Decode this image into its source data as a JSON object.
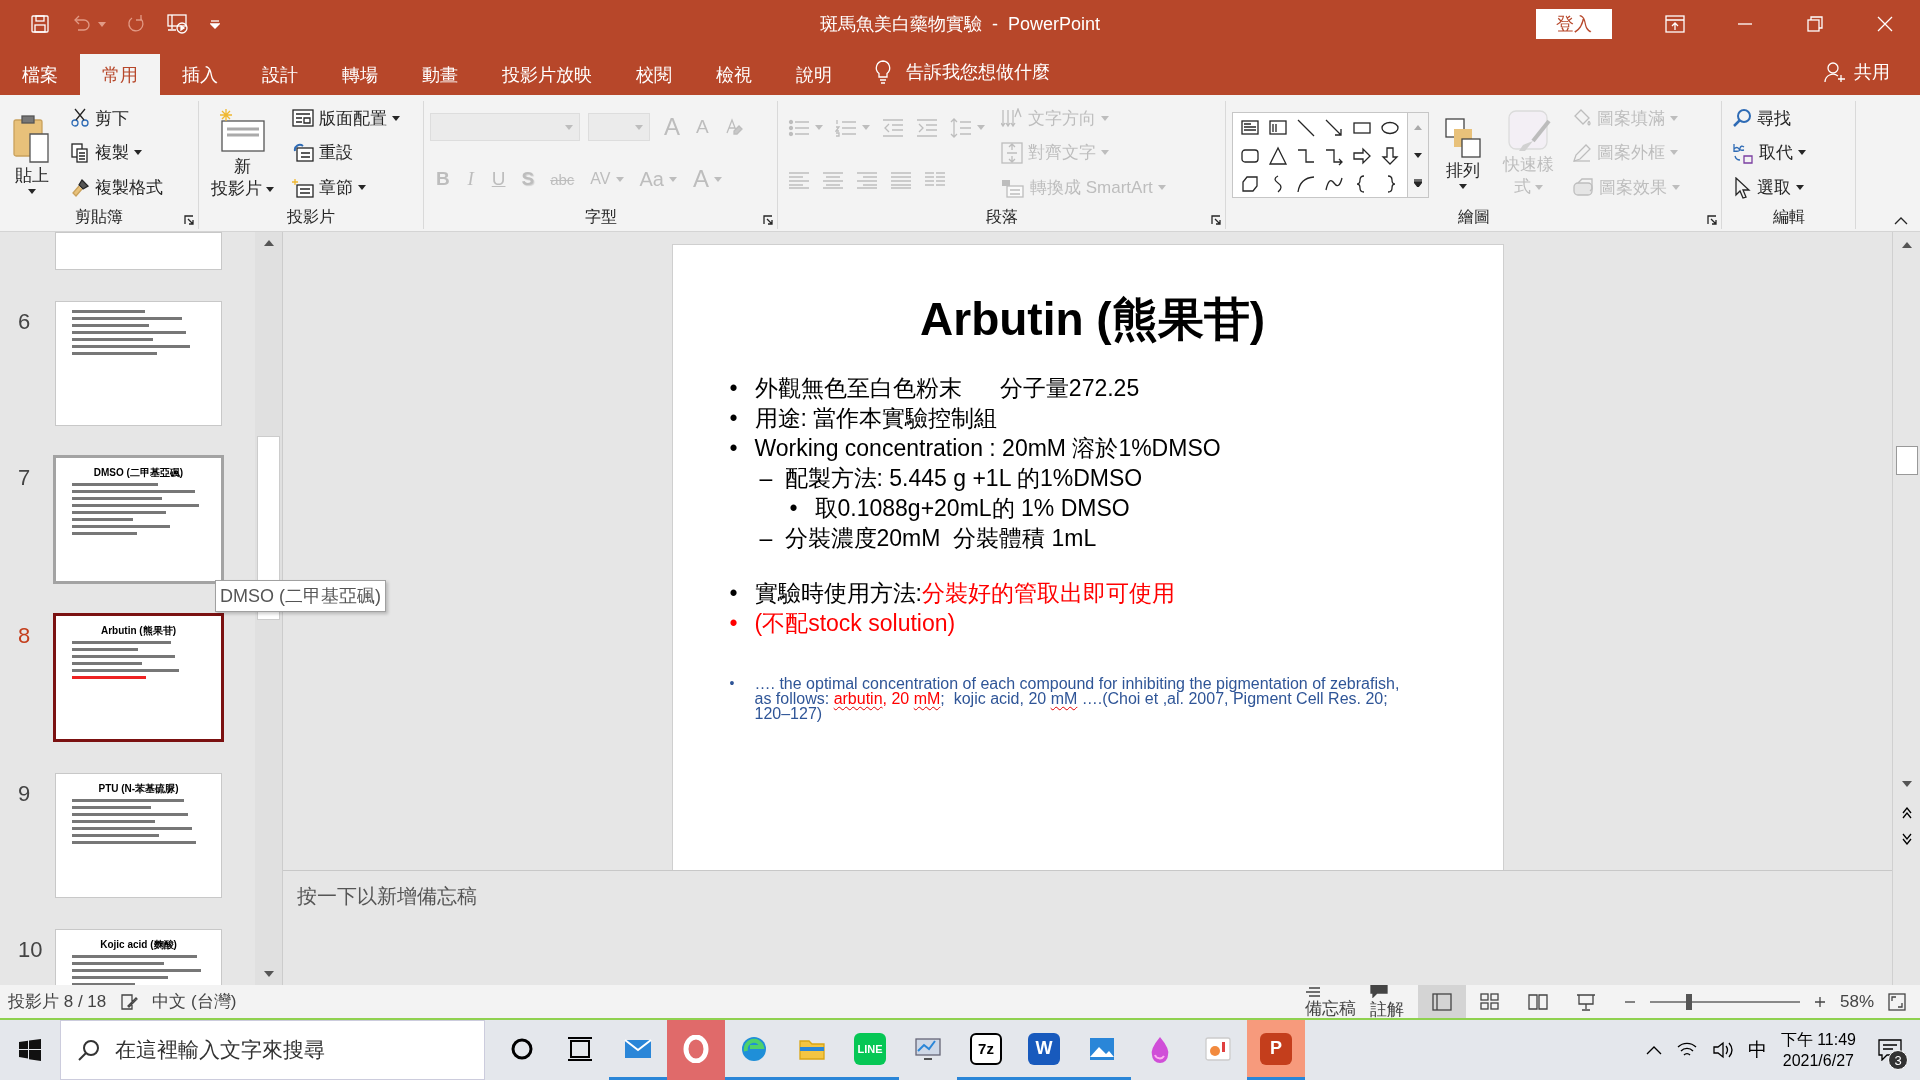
{
  "window": {
    "title": "斑馬魚美白藥物實驗  -  PowerPoint",
    "sign_in": "登入"
  },
  "menu_tabs": [
    {
      "label": "檔案",
      "selected": false
    },
    {
      "label": "常用",
      "selected": true
    },
    {
      "label": "插入",
      "selected": false
    },
    {
      "label": "設計",
      "selected": false
    },
    {
      "label": "轉場",
      "selected": false
    },
    {
      "label": "動畫",
      "selected": false
    },
    {
      "label": "投影片放映",
      "selected": false
    },
    {
      "label": "校閱",
      "selected": false
    },
    {
      "label": "檢視",
      "selected": false
    },
    {
      "label": "說明",
      "selected": false
    }
  ],
  "tell_me": "告訴我您想做什麼",
  "share": "共用",
  "ribbon_groups": [
    {
      "label": "剪貼簿",
      "launcher": true,
      "columns": [
        {
          "rows": [
            {
              "items": [
                {
                  "kind": "large",
                  "lines": [
                    "貼上"
                  ],
                  "dropdown": true,
                  "disabled": false
                }
              ]
            }
          ]
        },
        {
          "rows": [
            {
              "items": [
                {
                  "kind": "small",
                  "label": "剪下",
                  "dropdown": false,
                  "disabled": false
                }
              ]
            },
            {
              "items": [
                {
                  "kind": "small",
                  "label": "複製",
                  "dropdown": true,
                  "disabled": false
                }
              ]
            },
            {
              "items": [
                {
                  "kind": "small",
                  "label": "複製格式",
                  "dropdown": false,
                  "disabled": false
                }
              ]
            }
          ]
        }
      ]
    },
    {
      "label": "投影片",
      "launcher": false,
      "columns": [
        {
          "rows": [
            {
              "items": [
                {
                  "kind": "large",
                  "lines": [
                    "新",
                    "投影片"
                  ],
                  "dropdown": true,
                  "disabled": false
                }
              ]
            }
          ]
        },
        {
          "rows": [
            {
              "items": [
                {
                  "kind": "small",
                  "label": "版面配置",
                  "dropdown": true,
                  "disabled": false
                }
              ]
            },
            {
              "items": [
                {
                  "kind": "small",
                  "label": "重設",
                  "dropdown": false,
                  "disabled": false
                }
              ]
            },
            {
              "items": [
                {
                  "kind": "small",
                  "label": "章節",
                  "dropdown": true,
                  "disabled": false
                }
              ]
            }
          ]
        }
      ]
    },
    {
      "label": "字型",
      "launcher": true,
      "columns": [
        {
          "rows": [
            {
              "items": [
                {
                  "kind": "combo",
                  "dropdown": true,
                  "disabled": true
                },
                {
                  "kind": "combo",
                  "dropdown": true,
                  "disabled": true
                },
                {
                  "kind": "glyph",
                  "label": "A",
                  "dropdown": false,
                  "disabled": true
                },
                {
                  "kind": "glyph",
                  "label": "A",
                  "dropdown": false,
                  "disabled": true
                },
                {
                  "kind": "icon",
                  "dropdown": false,
                  "disabled": true
                }
              ]
            },
            {
              "items": [
                {
                  "kind": "glyph",
                  "label": "B",
                  "dropdown": false,
                  "disabled": true
                },
                {
                  "kind": "glyph",
                  "label": "I",
                  "dropdown": false,
                  "disabled": true
                },
                {
                  "kind": "glyph",
                  "label": "U",
                  "dropdown": false,
                  "disabled": true
                },
                {
                  "kind": "glyph",
                  "label": "S",
                  "dropdown": false,
                  "disabled": true
                },
                {
                  "kind": "glyph",
                  "label": "abc",
                  "dropdown": false,
                  "disabled": true
                },
                {
                  "kind": "glyph",
                  "label": "AV",
                  "dropdown": true,
                  "disabled": true
                },
                {
                  "kind": "glyph",
                  "label": "Aa",
                  "dropdown": true,
                  "disabled": true
                },
                {
                  "kind": "glyph",
                  "label": "A",
                  "dropdown": true,
                  "disabled": true
                }
              ]
            }
          ]
        }
      ]
    },
    {
      "label": "段落",
      "launcher": true,
      "columns": [
        {
          "rows": [
            {
              "items": [
                {
                  "kind": "icon",
                  "dropdown": true,
                  "disabled": true
                },
                {
                  "kind": "icon",
                  "dropdown": true,
                  "disabled": true
                },
                {
                  "kind": "icon",
                  "dropdown": false,
                  "disabled": true
                },
                {
                  "kind": "icon",
                  "dropdown": false,
                  "disabled": true
                },
                {
                  "kind": "icon",
                  "dropdown": true,
                  "disabled": true
                }
              ]
            },
            {
              "items": [
                {
                  "kind": "icon",
                  "dropdown": false,
                  "disabled": true
                },
                {
                  "kind": "icon",
                  "dropdown": false,
                  "disabled": true
                },
                {
                  "kind": "icon",
                  "dropdown": false,
                  "disabled": true
                },
                {
                  "kind": "icon",
                  "dropdown": false,
                  "disabled": true
                },
                {
                  "kind": "icon",
                  "dropdown": false,
                  "disabled": true
                }
              ]
            }
          ]
        },
        {
          "rows": [
            {
              "items": [
                {
                  "kind": "small",
                  "label": "文字方向",
                  "dropdown": true,
                  "disabled": true
                }
              ]
            },
            {
              "items": [
                {
                  "kind": "small",
                  "label": "對齊文字",
                  "dropdown": true,
                  "disabled": true
                }
              ]
            },
            {
              "items": [
                {
                  "kind": "small",
                  "label": "轉換成 SmartArt",
                  "dropdown": true,
                  "disabled": true
                }
              ]
            }
          ]
        }
      ]
    },
    {
      "label": "繪圖",
      "launcher": true,
      "columns": [
        {
          "rows": [
            {
              "items": [
                {
                  "kind": "gallery"
                }
              ]
            }
          ]
        },
        {
          "rows": [
            {
              "items": [
                {
                  "kind": "large",
                  "lines": [
                    "排列"
                  ],
                  "dropdown": true,
                  "disabled": false
                }
              ]
            }
          ]
        },
        {
          "rows": [
            {
              "items": [
                {
                  "kind": "large",
                  "lines": [
                    "快速樣",
                    "式"
                  ],
                  "dropdown": true,
                  "disabled": true
                }
              ]
            }
          ]
        },
        {
          "rows": [
            {
              "items": [
                {
                  "kind": "small",
                  "label": "圖案填滿",
                  "dropdown": true,
                  "disabled": true
                }
              ]
            },
            {
              "items": [
                {
                  "kind": "small",
                  "label": "圖案外框",
                  "dropdown": true,
                  "disabled": true
                }
              ]
            },
            {
              "items": [
                {
                  "kind": "small",
                  "label": "圖案效果",
                  "dropdown": true,
                  "disabled": true
                }
              ]
            }
          ]
        }
      ]
    },
    {
      "label": "編輯",
      "launcher": false,
      "columns": [
        {
          "rows": [
            {
              "items": [
                {
                  "kind": "small",
                  "label": "尋找",
                  "dropdown": false,
                  "disabled": false
                }
              ]
            },
            {
              "items": [
                {
                  "kind": "small",
                  "label": "取代",
                  "dropdown": true,
                  "disabled": false
                }
              ]
            },
            {
              "items": [
                {
                  "kind": "small",
                  "label": "選取",
                  "dropdown": true,
                  "disabled": false
                }
              ]
            }
          ]
        }
      ]
    }
  ],
  "thumbnails": [
    {
      "kind": "cut",
      "selected": false,
      "hovered": false
    },
    {
      "kind": "full",
      "number": "6",
      "selected": false,
      "hovered": false
    },
    {
      "kind": "full",
      "number": "7",
      "title": "DMSO (二甲基亞碸)",
      "selected": false,
      "hovered": true
    },
    {
      "kind": "full",
      "number": "8",
      "title": "Arbutin (熊果苷)",
      "selected": true,
      "hovered": false
    },
    {
      "kind": "full",
      "number": "9",
      "title": "PTU (N-苯基硫脲)",
      "selected": false,
      "hovered": false
    },
    {
      "kind": "full",
      "number": "10",
      "title": "Kojic acid (麴酸)",
      "selected": false,
      "hovered": false
    }
  ],
  "tooltip": "DMSO (二甲基亞碸)",
  "slide": {
    "title": "Arbutin (熊果苷)",
    "bullets": [
      {
        "kind": "main",
        "marker": "•",
        "color": "#000000",
        "separated": false,
        "segments": [
          {
            "text": "外觀無色至白色粉末      分子量272.25",
            "color": "#000000"
          }
        ]
      },
      {
        "kind": "main",
        "marker": "•",
        "color": "#000000",
        "separated": false,
        "segments": [
          {
            "text": "用途: 當作本實驗控制組",
            "color": "#000000"
          }
        ]
      },
      {
        "kind": "main",
        "marker": "•",
        "color": "#000000",
        "separated": false,
        "segments": [
          {
            "text": "Working concentration : 20mM 溶於1%DMSO",
            "color": "#000000"
          }
        ],
        "children": [
          {
            "kind": "main",
            "marker": "–",
            "color": "#000000",
            "separated": false,
            "segments": [
              {
                "text": "配製方法: 5.445 g +1L 的1%DMSO",
                "color": "#000000"
              }
            ],
            "children": [
              {
                "kind": "main",
                "marker": "•",
                "color": "#000000",
                "separated": false,
                "segments": [
                  {
                    "text": "取0.1088g+20mL的 1% DMSO",
                    "color": "#000000"
                  }
                ]
              }
            ]
          },
          {
            "kind": "main",
            "marker": "–",
            "color": "#000000",
            "separated": false,
            "segments": [
              {
                "text": "分裝濃度20mM  分裝體積 1mL",
                "color": "#000000"
              }
            ]
          }
        ]
      },
      {
        "kind": "main",
        "marker": "•",
        "color": "#000000",
        "separated": true,
        "segments": [
          {
            "text": "實驗時使用方法:",
            "color": "#000000"
          },
          {
            "text": "分裝好的管取出即可使用",
            "color": "#ff0000"
          }
        ]
      },
      {
        "kind": "main",
        "marker": "•",
        "color": "#ff0000",
        "separated": false,
        "segments": [
          {
            "text": "(不配stock solution)",
            "color": "#ff0000"
          }
        ]
      },
      {
        "kind": "reference",
        "marker": "•",
        "color": "#2f5597",
        "separated": true,
        "segments": [
          {
            "text": "…. the optimal concentration of each compound for inhibiting the pigmentation of zebrafish, as follows: ",
            "color": "#2f5597"
          },
          {
            "text": "arbutin",
            "color": "#ff0000",
            "spellcheck": true
          },
          {
            "text": ", 20 ",
            "color": "#ff0000"
          },
          {
            "text": "mM",
            "color": "#ff0000",
            "spellcheck": true
          },
          {
            "text": ";  kojic acid, 20 ",
            "color": "#2f5597"
          },
          {
            "text": "mM",
            "color": "#2f5597",
            "spellcheck": true
          },
          {
            "text": " ….(Choi et ,al. 2007, Pigment Cell Res. 20; 120–127)",
            "color": "#2f5597"
          }
        ]
      }
    ]
  },
  "notes_placeholder": "按一下以新增備忘稿",
  "status_bar": {
    "slide": "投影片 8 / 18",
    "language": "中文 (台灣)",
    "notes": "備忘稿",
    "comments": "註解",
    "views": [
      {
        "selected": true
      },
      {
        "selected": false
      },
      {
        "selected": false
      },
      {
        "selected": false
      }
    ],
    "zoom": {
      "level": 0.26
    },
    "zoom_text": "58%"
  },
  "taskbar": {
    "search_placeholder": "在這裡輸入文字來搜尋",
    "apps": [
      {
        "running": false,
        "active": false,
        "attention": false
      },
      {
        "running": false,
        "active": false,
        "attention": false
      },
      {
        "running": true,
        "active": false,
        "attention": false
      },
      {
        "running": false,
        "active": false,
        "attention": true
      },
      {
        "running": true,
        "active": false,
        "attention": false
      },
      {
        "running": true,
        "active": false,
        "attention": false
      },
      {
        "glyph": "LINE",
        "running": true,
        "active": false,
        "attention": false
      },
      {
        "running": false,
        "active": false,
        "attention": false
      },
      {
        "glyph": "7z",
        "running": true,
        "active": false,
        "attention": false
      },
      {
        "glyph": "W",
        "running": true,
        "active": false,
        "attention": false
      },
      {
        "running": true,
        "active": false,
        "attention": false
      },
      {
        "running": false,
        "active": false,
        "attention": false
      },
      {
        "running": false,
        "active": false,
        "attention": false
      },
      {
        "glyph": "P",
        "running": true,
        "active": true,
        "attention": false
      }
    ],
    "ime": "中",
    "time": "下午 11:49",
    "date": "2021/6/27",
    "notifications": "3"
  }
}
